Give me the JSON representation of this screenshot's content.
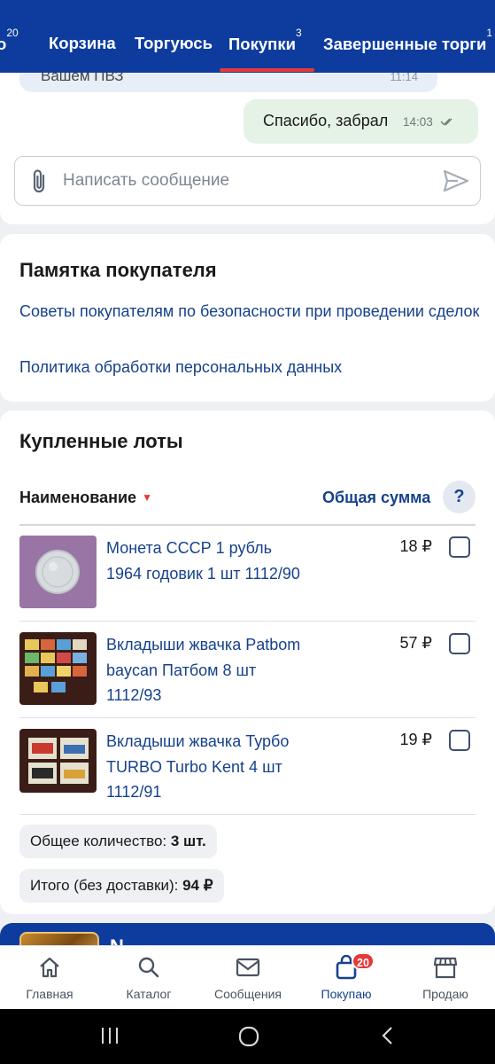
{
  "header": {
    "tabs": [
      {
        "label": "о",
        "badge": "20"
      },
      {
        "label": "Корзина",
        "badge": ""
      },
      {
        "label": "Торгуюсь",
        "badge": ""
      },
      {
        "label": "Покупки",
        "badge": "3",
        "active": true
      },
      {
        "label": "Завершенные торги",
        "badge": "1"
      }
    ]
  },
  "chat": {
    "incoming_clip_text": "Вашем ПВЗ",
    "incoming_clip_time": "11:14",
    "outgoing_text": "Спасибо, забрал",
    "outgoing_time": "14:03",
    "input_placeholder": "Написать сообщение"
  },
  "memo": {
    "title": "Памятка покупателя",
    "link_safety": "Советы покупателям по безопасности при проведении сделок",
    "link_privacy": "Политика обработки персональных данных"
  },
  "lots": {
    "title": "Купленные лоты",
    "col_name": "Наименование",
    "col_sum": "Общая сумма",
    "help": "?",
    "items": [
      {
        "title": "Монета СССР 1 рубль 1964 годовик 1 шт 1112/90",
        "price": "18 ₽"
      },
      {
        "title": "Вкладыши жвачка Patbom baycan Патбом 8 шт 1112/93",
        "price": "57 ₽"
      },
      {
        "title": "Вкладыши жвачка Турбо TURBO Turbo Kent 4 шт 1112/91",
        "price": "19 ₽"
      }
    ],
    "total_qty_label": "Общее количество:",
    "total_qty_value": "3 шт.",
    "total_sum_label": "Итого (без доставки):",
    "total_sum_value": "94 ₽"
  },
  "promo": {
    "title": "N"
  },
  "bottom_nav": [
    {
      "label": "Главная",
      "icon": "home-icon"
    },
    {
      "label": "Каталог",
      "icon": "search-icon"
    },
    {
      "label": "Сообщения",
      "icon": "mail-icon"
    },
    {
      "label": "Покупаю",
      "icon": "bag-icon",
      "badge": "20",
      "active": true
    },
    {
      "label": "Продаю",
      "icon": "store-icon"
    }
  ],
  "colors": {
    "brand": "#0d3c9e",
    "link": "#16418c",
    "accent_red": "#e53935",
    "outgoing_bubble": "#e4f3e6"
  }
}
